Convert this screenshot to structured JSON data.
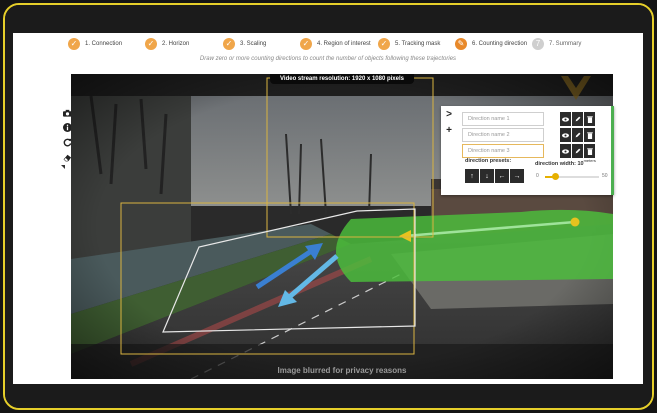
{
  "steps": [
    {
      "num": "1",
      "label": "1. Connection",
      "state": "done"
    },
    {
      "num": "2",
      "label": "2. Horizon",
      "state": "done"
    },
    {
      "num": "3",
      "label": "3. Scaling",
      "state": "done"
    },
    {
      "num": "4",
      "label": "4. Region of interest",
      "state": "done"
    },
    {
      "num": "5",
      "label": "5. Tracking mask",
      "state": "done"
    },
    {
      "num": "6",
      "label": "6. Counting direction",
      "state": "active"
    },
    {
      "num": "7",
      "label": "7. Summary",
      "state": "pending"
    }
  ],
  "instruction": "Draw zero or more counting directions to count the number of objects following these trajectories",
  "video": {
    "resolution_label": "Video stream resolution: 1920 x 1080 pixels",
    "privacy_label": "Image blurred for privacy reasons"
  },
  "side_tools": [
    "camera-icon",
    "info-icon",
    "refresh-icon",
    "eraser-icon"
  ],
  "panel": {
    "collapse_symbol": ">",
    "add_symbol": "+",
    "directions": [
      {
        "placeholder": "Direction name 1"
      },
      {
        "placeholder": "Direction name 2"
      },
      {
        "placeholder": "Direction name 3"
      }
    ],
    "presets_label": "direction presets:",
    "width_label": "direction width: 10",
    "width_unit": "meters",
    "width_value": 10,
    "width_min": "0",
    "width_max": "50",
    "presets": [
      "↑",
      "↓",
      "←",
      "→"
    ]
  },
  "colors": {
    "frame": "#e6cf2a",
    "step_done": "#f0a64a",
    "roi": "#d9b441",
    "direction_zone": "#4cbf3c",
    "arrow_blue": "#3a7fd1",
    "arrow_light": "#63b8e6"
  }
}
